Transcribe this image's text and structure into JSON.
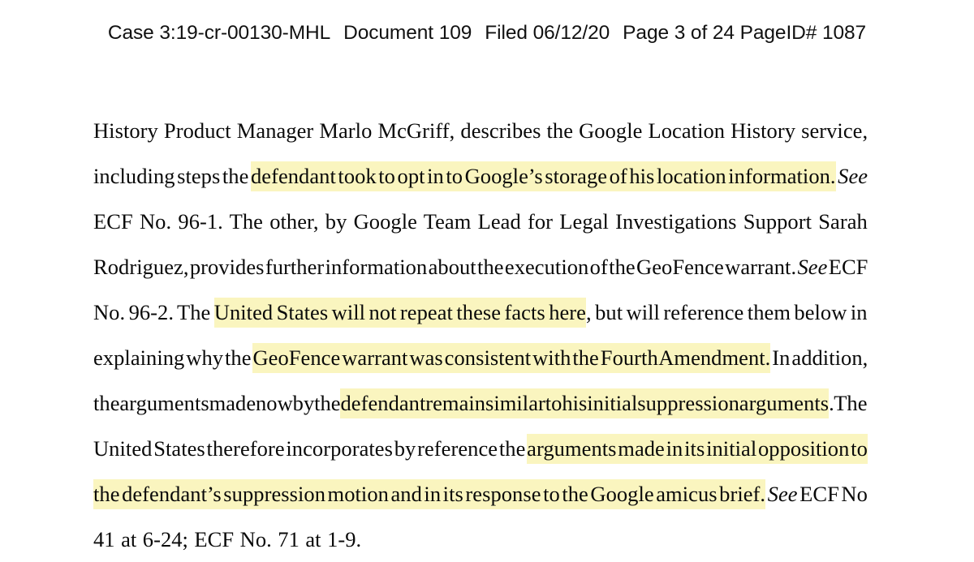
{
  "document": {
    "header": {
      "case_label": "Case 3:19-cr-00130-MHL",
      "document_label": "Document 109",
      "filed_label": "Filed 06/12/20",
      "page_label": "Page 3 of 24 PageID# 1087"
    },
    "colors": {
      "highlight": "#faf5bf",
      "text": "#0a0a0a",
      "background": "#ffffff"
    },
    "lines": [
      {
        "n": 1,
        "segments": [
          {
            "text": "History Product Manager Marlo McGriff, describes the Google Location History service,",
            "highlight": false,
            "italic": false
          }
        ]
      },
      {
        "n": 2,
        "segments": [
          {
            "text": "including steps the ",
            "highlight": false,
            "italic": false
          },
          {
            "text": "defendant took to opt in to Google’s storage of his location information.",
            "highlight": true,
            "italic": false
          },
          {
            "text": "  ",
            "highlight": false,
            "italic": false
          },
          {
            "text": "See",
            "highlight": false,
            "italic": true
          }
        ]
      },
      {
        "n": 3,
        "segments": [
          {
            "text": "ECF No. 96-1. The other, by Google Team Lead for Legal Investigations Support Sarah",
            "highlight": false,
            "italic": false
          }
        ]
      },
      {
        "n": 4,
        "segments": [
          {
            "text": "Rodriguez, provides further information about the execution of the GeoFence warrant.",
            "highlight": false,
            "italic": false
          },
          {
            "text": "  ",
            "highlight": false,
            "italic": false
          },
          {
            "text": "See",
            "highlight": false,
            "italic": true
          },
          {
            "text": " ECF",
            "highlight": false,
            "italic": false
          }
        ]
      },
      {
        "n": 5,
        "segments": [
          {
            "text": "No. 96-2.  The ",
            "highlight": false,
            "italic": false
          },
          {
            "text": "United States will not repeat these facts here",
            "highlight": true,
            "italic": false
          },
          {
            "text": ", but will reference them below in",
            "highlight": false,
            "italic": false
          }
        ]
      },
      {
        "n": 6,
        "segments": [
          {
            "text": "explaining why the ",
            "highlight": false,
            "italic": false
          },
          {
            "text": "GeoFence warrant was consistent with the Fourth Amendment.",
            "highlight": true,
            "italic": false
          },
          {
            "text": "  In addition,",
            "highlight": false,
            "italic": false
          }
        ]
      },
      {
        "n": 7,
        "segments": [
          {
            "text": "the arguments made now by the ",
            "highlight": false,
            "italic": false
          },
          {
            "text": "defendant remain similar to his initial suppression arguments",
            "highlight": true,
            "italic": false
          },
          {
            "text": ".  The",
            "highlight": false,
            "italic": false
          }
        ]
      },
      {
        "n": 8,
        "segments": [
          {
            "text": "United States therefore incorporates by reference the ",
            "highlight": false,
            "italic": false
          },
          {
            "text": "arguments made in its initial opposition to",
            "highlight": true,
            "italic": false
          }
        ]
      },
      {
        "n": 9,
        "segments": [
          {
            "text": "the defendant’s suppression motion and in its response to the Google amicus brief.",
            "highlight": true,
            "italic": false
          },
          {
            "text": "  ",
            "highlight": false,
            "italic": false
          },
          {
            "text": "See",
            "highlight": false,
            "italic": true
          },
          {
            "text": " ECF No",
            "highlight": false,
            "italic": false
          }
        ]
      },
      {
        "n": 10,
        "segments": [
          {
            "text": "41 at 6-24; ECF No. 71 at 1-9.",
            "highlight": false,
            "italic": false
          }
        ]
      }
    ]
  }
}
